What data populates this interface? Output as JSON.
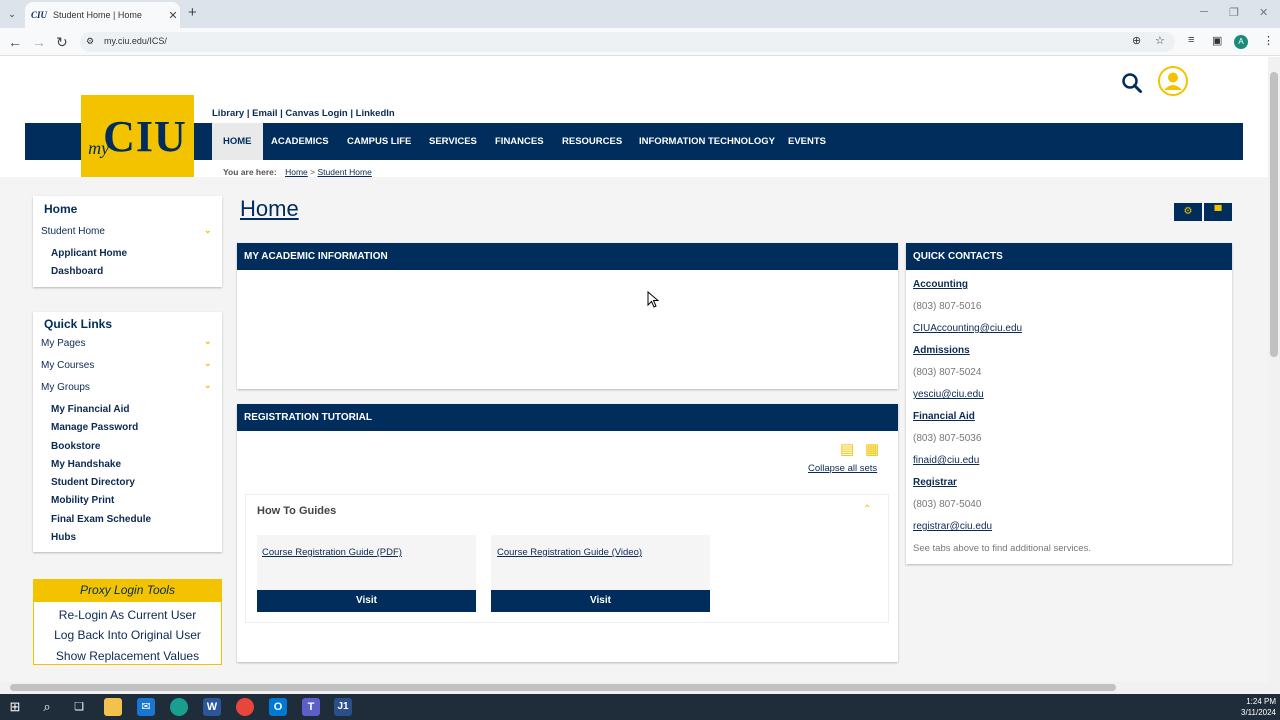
{
  "browser": {
    "tab_favicon": "CIU",
    "tab_title": "Student Home | Home",
    "tab_close": "✕",
    "new_tab": "+",
    "url": "my.ciu.edu/ICS/"
  },
  "header": {
    "logo_my": "my",
    "logo_ciu": "CIU",
    "top_links": "Library | Email | Canvas Login | LinkedIn",
    "nav": [
      "HOME",
      "ACADEMICS",
      "CAMPUS LIFE",
      "SERVICES",
      "FINANCES",
      "RESOURCES",
      "INFORMATION TECHNOLOGY",
      "EVENTS"
    ],
    "breadcrumb_label": "You are here:",
    "breadcrumb_home": "Home",
    "breadcrumb_sep": ">",
    "breadcrumb_current": "Student Home"
  },
  "sidebar": {
    "home_title": "Home",
    "student_home": "Student Home",
    "home_items": [
      "Applicant Home",
      "Dashboard"
    ],
    "quick_links_title": "Quick Links",
    "quick_groups": [
      "My Pages",
      "My Courses",
      "My Groups"
    ],
    "quick_items": [
      "My Financial Aid",
      "Manage Password",
      "Bookstore",
      "My Handshake",
      "Student Directory",
      "Mobility Print",
      "Final Exam Schedule",
      "Hubs"
    ],
    "proxy_title": "Proxy Login Tools",
    "proxy_items": [
      "Re-Login As Current User",
      "Log Back Into Original User",
      "Show Replacement Values"
    ]
  },
  "main": {
    "title": "Home",
    "academic_title": "MY ACADEMIC INFORMATION",
    "registration_title": "REGISTRATION TUTORIAL",
    "collapse_all": "Collapse all sets",
    "guides_title": "How To Guides",
    "guides": [
      {
        "link": "Course Registration Guide (PDF)",
        "button": "Visit"
      },
      {
        "link": "Course Registration Guide (Video)",
        "button": "Visit"
      }
    ]
  },
  "quick_contacts": {
    "title": "QUICK CONTACTS",
    "contacts": [
      {
        "name": "Accounting",
        "phone": "(803) 807-5016",
        "email": "CIUAccounting@ciu.edu"
      },
      {
        "name": "Admissions",
        "phone": "(803) 807-5024",
        "email": "yesciu@ciu.edu"
      },
      {
        "name": "Financial Aid",
        "phone": "(803) 807-5036",
        "email": "finaid@ciu.edu"
      },
      {
        "name": "Registrar",
        "phone": "(803) 807-5040",
        "email": "registrar@ciu.edu"
      }
    ],
    "note": "See tabs above to find additional services."
  },
  "taskbar": {
    "time": "1:24 PM",
    "date": "3/11/2024"
  },
  "colors": {
    "navy": "#002d5b",
    "gold": "#f3c300"
  }
}
